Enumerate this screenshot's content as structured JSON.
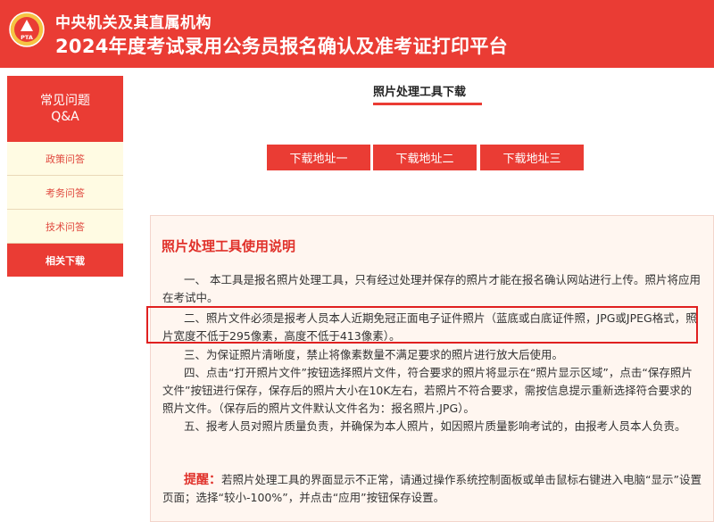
{
  "header": {
    "org_name": "中央机关及其直属机构",
    "platform_title": "2024年度考试录用公务员报名确认及准考证打印平台",
    "logo_icon": "pta-logo-icon",
    "logo_text": "PTA",
    "colors": {
      "brand_red": "#ea3c34",
      "highlight_red": "#e02020",
      "sidebar_bg": "#fffbe3"
    }
  },
  "sidebar": {
    "heading_line1": "常见问题",
    "heading_line2": "Q&A",
    "items": [
      {
        "label": "政策问答"
      },
      {
        "label": "考务问答"
      },
      {
        "label": "技术问答"
      },
      {
        "label": "相关下载"
      }
    ]
  },
  "main": {
    "tab_title": "照片处理工具下载",
    "download_buttons": [
      {
        "label": "下载地址一"
      },
      {
        "label": "下载地址二"
      },
      {
        "label": "下载地址三"
      }
    ],
    "instructions": {
      "title": "照片处理工具使用说明",
      "paragraphs": [
        "一、 本工具是报名照片处理工具，只有经过处理并保存的照片才能在报名确认网站进行上传。照片将应用在考试中。",
        "二、照片文件必须是报考人员本人近期免冠正面电子证件照片（蓝底或白底证件照，JPG或JPEG格式，照片宽度不低于295像素，高度不低于413像素）。",
        "三、为保证照片清晰度，禁止将像素数量不满足要求的照片进行放大后使用。",
        "四、点击“打开照片文件”按钮选择照片文件，符合要求的照片将显示在“照片显示区域”，点击“保存照片文件”按钮进行保存，保存后的照片大小在10K左右，若照片不符合要求，需按信息提示重新选择符合要求的照片文件。（保存后的照片文件默认文件名为：报名照片.JPG）。",
        "五、报考人员对照片质量负责，并确保为本人照片，如因照片质量影响考试的，由报考人员本人负责。"
      ],
      "reminder_label": "提醒：",
      "reminder_text": "若照片处理工具的界面显示不正常，请通过操作系统控制面板或单击鼠标右键进入电脑“显示”设置页面；选择“较小-100%”，并点击“应用”按钮保存设置。"
    }
  }
}
